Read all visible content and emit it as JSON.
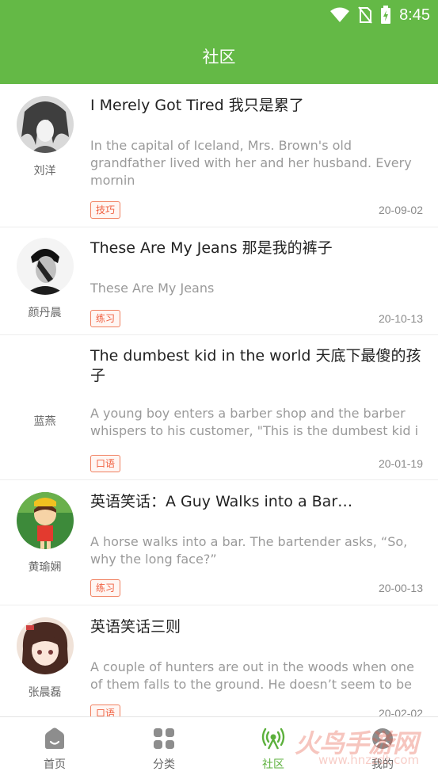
{
  "status_bar": {
    "time": "8:45"
  },
  "app": {
    "title": "社区",
    "accent": "#64b946"
  },
  "posts": [
    {
      "author": "刘洋",
      "avatar": "manga-character-avatar",
      "title": "I Merely Got Tired 我只是累了",
      "excerpt": "In the capital of Iceland, Mrs. Brown's old grandfather lived with her and her husband. Every mornin",
      "tag": "技巧",
      "date": "20-09-02"
    },
    {
      "author": "颜丹晨",
      "avatar": "bw-photo-avatar",
      "title": "These Are My Jeans 那是我的裤子",
      "excerpt": "These Are My Jeans",
      "tag": "练习",
      "date": "20-10-13"
    },
    {
      "author": "蓝燕",
      "avatar": "",
      "title": "The dumbest kid in the world 天底下最傻的孩子",
      "excerpt": "A young boy enters a barber shop and the barber whispers to his customer, \"This is the dumbest kid i",
      "tag": "口语",
      "date": "20-01-19"
    },
    {
      "author": "黄瑜娴",
      "avatar": "cartoon-girl-avatar",
      "title": "英语笑话：A Guy Walks into a Bar…",
      "excerpt": "A horse walks into a bar. The bartender asks, “So, why the long face?”",
      "tag": "练习",
      "date": "20-00-13"
    },
    {
      "author": "张晨磊",
      "avatar": "anime-girl-avatar",
      "title": "英语笑话三则",
      "excerpt": "A couple of hunters are out in the woods when one of them falls to the ground. He doesn’t seem to be",
      "tag": "口语",
      "date": "20-02-02"
    }
  ],
  "nav": [
    {
      "label": "首页",
      "icon": "home-icon",
      "active": false
    },
    {
      "label": "分类",
      "icon": "grid-icon",
      "active": false
    },
    {
      "label": "社区",
      "icon": "community-icon",
      "active": true
    },
    {
      "label": "我的",
      "icon": "profile-icon",
      "active": false
    }
  ],
  "watermark": {
    "text": "火鸟手游网",
    "url": "www.hnzzdt.com"
  }
}
